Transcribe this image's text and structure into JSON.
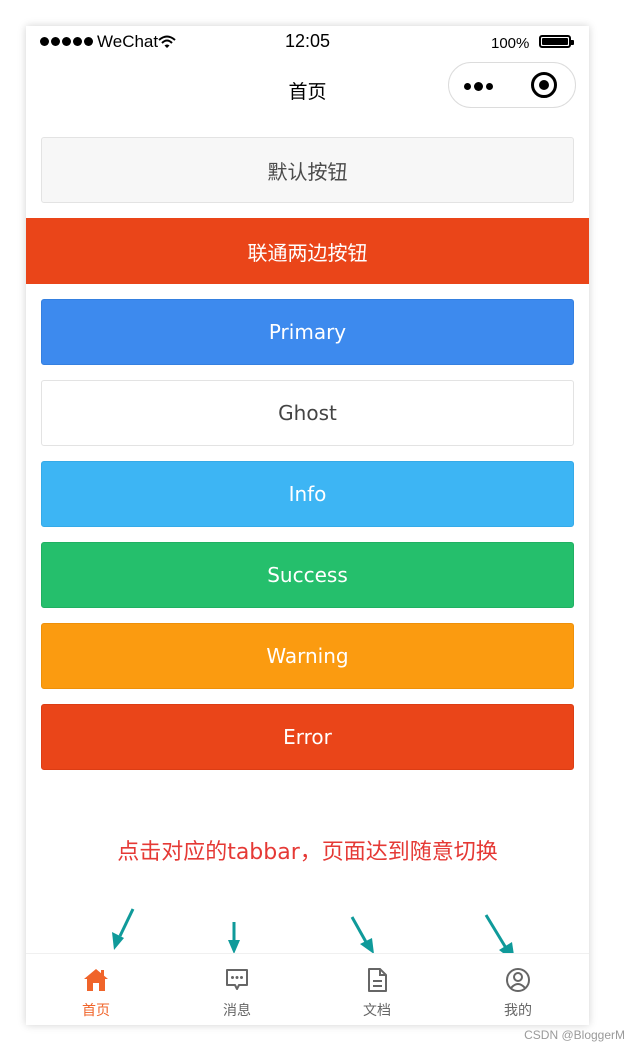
{
  "status_bar": {
    "carrier": "WeChat",
    "time": "12:05",
    "battery": "100%"
  },
  "nav": {
    "title": "首页"
  },
  "buttons": {
    "default": "默认按钮",
    "block": "联通两边按钮",
    "primary": "Primary",
    "ghost": "Ghost",
    "info": "Info",
    "success": "Success",
    "warning": "Warning",
    "error": "Error"
  },
  "annotation": "点击对应的tabbar，页面达到随意切换",
  "tabbar": {
    "items": [
      {
        "label": "首页",
        "icon": "home-icon",
        "active": true
      },
      {
        "label": "消息",
        "icon": "message-icon",
        "active": false
      },
      {
        "label": "文档",
        "icon": "document-icon",
        "active": false
      },
      {
        "label": "我的",
        "icon": "user-icon",
        "active": false
      }
    ]
  },
  "watermark": "CSDN @BloggerM",
  "colors": {
    "accent": "#f0642a",
    "primary": "#3d8aee",
    "info": "#3db5f4",
    "success": "#25bf6c",
    "warning": "#fb9b10",
    "error": "#ea4519",
    "arrow": "#0f9a9a",
    "annotation": "#e53935"
  }
}
